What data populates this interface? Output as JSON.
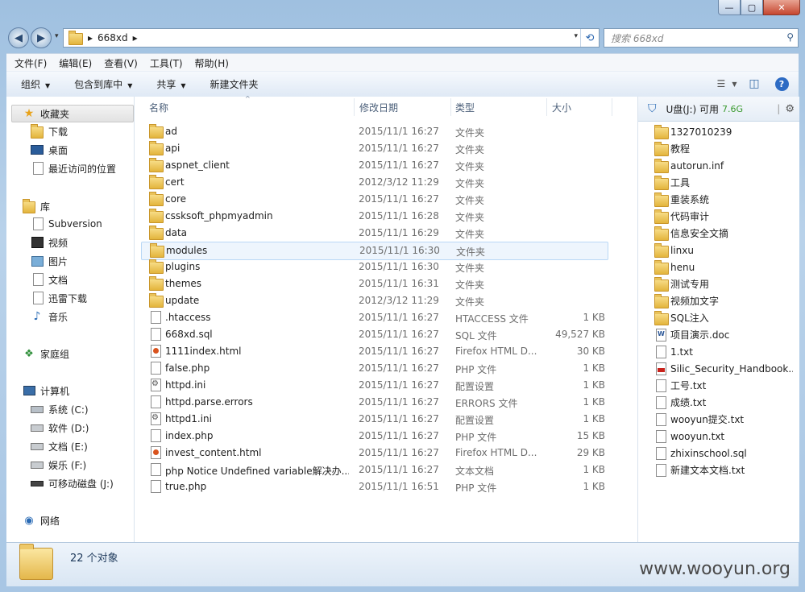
{
  "window": {
    "min_label": "—",
    "max_label": "▢",
    "close_label": "✕"
  },
  "address": {
    "segment1": "▸",
    "folder": "668xd",
    "segment2": "▸",
    "history_arrow": "▾",
    "dropdown": "▾"
  },
  "search": {
    "placeholder": "搜索 668xd"
  },
  "menu": [
    "文件(F)",
    "编辑(E)",
    "查看(V)",
    "工具(T)",
    "帮助(H)"
  ],
  "toolbar": {
    "organize": "组织",
    "include_library": "包含到库中",
    "share": "共享",
    "new_folder": "新建文件夹"
  },
  "navpane": {
    "favorites": "收藏夹",
    "downloads": "下载",
    "desktop": "桌面",
    "recent": "最近访问的位置",
    "libraries": "库",
    "subversion": "Subversion",
    "videos": "视频",
    "pictures": "图片",
    "documents": "文档",
    "thunder": "迅雷下载",
    "music": "音乐",
    "homegroup": "家庭组",
    "computer": "计算机",
    "drive_c": "系统 (C:)",
    "drive_d": "软件 (D:)",
    "drive_e": "文档 (E:)",
    "drive_f": "娱乐 (F:)",
    "drive_j": "可移动磁盘 (J:)",
    "network": "网络"
  },
  "columns": {
    "name": "名称",
    "date": "修改日期",
    "type": "类型",
    "size": "大小"
  },
  "files": [
    {
      "name": "ad",
      "date": "2015/11/1 16:27",
      "type": "文件夹",
      "size": "",
      "icon": "folder"
    },
    {
      "name": "api",
      "date": "2015/11/1 16:27",
      "type": "文件夹",
      "size": "",
      "icon": "folder"
    },
    {
      "name": "aspnet_client",
      "date": "2015/11/1 16:27",
      "type": "文件夹",
      "size": "",
      "icon": "folder"
    },
    {
      "name": "cert",
      "date": "2012/3/12 11:29",
      "type": "文件夹",
      "size": "",
      "icon": "folder"
    },
    {
      "name": "core",
      "date": "2015/11/1 16:27",
      "type": "文件夹",
      "size": "",
      "icon": "folder"
    },
    {
      "name": "cssksoft_phpmyadmin",
      "date": "2015/11/1 16:28",
      "type": "文件夹",
      "size": "",
      "icon": "folder"
    },
    {
      "name": "data",
      "date": "2015/11/1 16:29",
      "type": "文件夹",
      "size": "",
      "icon": "folder"
    },
    {
      "name": "modules",
      "date": "2015/11/1 16:30",
      "type": "文件夹",
      "size": "",
      "icon": "folder",
      "selected": true
    },
    {
      "name": "plugins",
      "date": "2015/11/1 16:30",
      "type": "文件夹",
      "size": "",
      "icon": "folder"
    },
    {
      "name": "themes",
      "date": "2015/11/1 16:31",
      "type": "文件夹",
      "size": "",
      "icon": "folder"
    },
    {
      "name": "update",
      "date": "2012/3/12 11:29",
      "type": "文件夹",
      "size": "",
      "icon": "folder"
    },
    {
      "name": ".htaccess",
      "date": "2015/11/1 16:27",
      "type": "HTACCESS 文件",
      "size": "1 KB",
      "icon": "doc"
    },
    {
      "name": "668xd.sql",
      "date": "2015/11/1 16:27",
      "type": "SQL 文件",
      "size": "49,527 KB",
      "icon": "doc"
    },
    {
      "name": "1111index.html",
      "date": "2015/11/1 16:27",
      "type": "Firefox HTML D...",
      "size": "30 KB",
      "icon": "ff"
    },
    {
      "name": "false.php",
      "date": "2015/11/1 16:27",
      "type": "PHP 文件",
      "size": "1 KB",
      "icon": "doc"
    },
    {
      "name": "httpd.ini",
      "date": "2015/11/1 16:27",
      "type": "配置设置",
      "size": "1 KB",
      "icon": "gear"
    },
    {
      "name": "httpd.parse.errors",
      "date": "2015/11/1 16:27",
      "type": "ERRORS 文件",
      "size": "1 KB",
      "icon": "doc"
    },
    {
      "name": "httpd1.ini",
      "date": "2015/11/1 16:27",
      "type": "配置设置",
      "size": "1 KB",
      "icon": "gear"
    },
    {
      "name": "index.php",
      "date": "2015/11/1 16:27",
      "type": "PHP 文件",
      "size": "15 KB",
      "icon": "doc"
    },
    {
      "name": "invest_content.html",
      "date": "2015/11/1 16:27",
      "type": "Firefox HTML D...",
      "size": "29 KB",
      "icon": "ff"
    },
    {
      "name": "php Notice Undefined variable解决办...",
      "date": "2015/11/1 16:27",
      "type": "文本文档",
      "size": "1 KB",
      "icon": "doc"
    },
    {
      "name": "true.php",
      "date": "2015/11/1 16:51",
      "type": "PHP 文件",
      "size": "1 KB",
      "icon": "doc"
    }
  ],
  "preview": {
    "drive_label": "U盘(J:)  可用",
    "free": "7.6G",
    "free_color": "#3a9a2e",
    "items": [
      {
        "name": "1327010239",
        "icon": "folder"
      },
      {
        "name": "教程",
        "icon": "folder"
      },
      {
        "name": "autorun.inf",
        "icon": "folder"
      },
      {
        "name": "工具",
        "icon": "folder"
      },
      {
        "name": "重装系统",
        "icon": "folder"
      },
      {
        "name": "代码审计",
        "icon": "folder"
      },
      {
        "name": "信息安全文摘",
        "icon": "folder"
      },
      {
        "name": "linxu",
        "icon": "folder"
      },
      {
        "name": "henu",
        "icon": "folder"
      },
      {
        "name": "测试专用",
        "icon": "folder"
      },
      {
        "name": "视频加文字",
        "icon": "folder"
      },
      {
        "name": "SQL注入",
        "icon": "folder"
      },
      {
        "name": "项目演示.doc",
        "icon": "word"
      },
      {
        "name": "1.txt",
        "icon": "doc"
      },
      {
        "name": "Silic_Security_Handbook...",
        "icon": "pdf"
      },
      {
        "name": "工号.txt",
        "icon": "doc"
      },
      {
        "name": "成绩.txt",
        "icon": "doc"
      },
      {
        "name": "wooyun提交.txt",
        "icon": "doc"
      },
      {
        "name": "wooyun.txt",
        "icon": "doc"
      },
      {
        "name": "zhixinschool.sql",
        "icon": "doc"
      },
      {
        "name": "新建文本文档.txt",
        "icon": "doc"
      }
    ]
  },
  "status": {
    "count": "22 个对象"
  },
  "watermark": "www.wooyun.org"
}
